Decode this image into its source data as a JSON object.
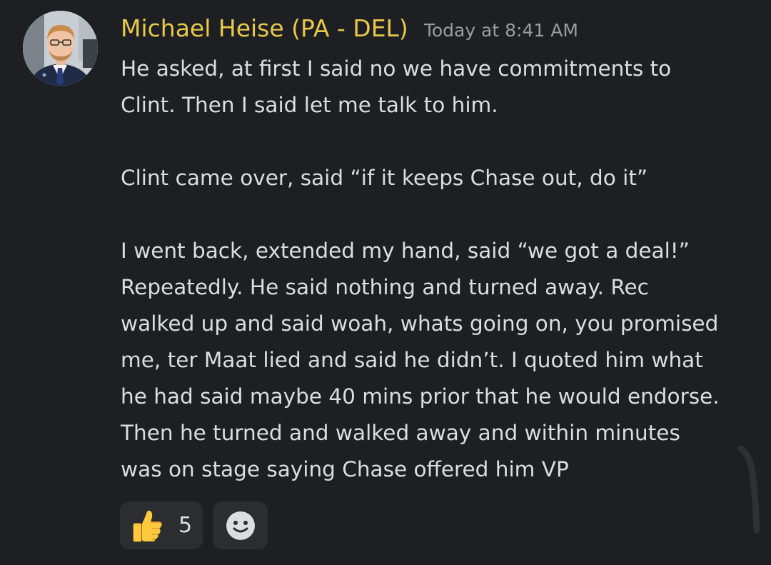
{
  "message": {
    "author": "Michael Heise (PA - DEL)",
    "timestamp": "Today at 8:41 AM",
    "avatar_icon": "user-avatar-photo",
    "author_color": "#e6c84a",
    "paragraphs": [
      [
        "He asked, at first I said no we have commitments to",
        "Clint. Then I said let me talk to him."
      ],
      [
        "Clint came over, said “if it keeps Chase out, do it”"
      ],
      [
        "I went back, extended my hand, said “we got a deal!”",
        "Repeatedly. He said nothing and turned away. Rec",
        "walked up and said woah, whats going on, you promised",
        "me, ter Maat lied and said he didn’t. I quoted him what",
        "he had said maybe 40 mins prior that he would endorse.",
        "Then he turned and walked away and within minutes",
        "was on stage saying Chase offered him VP"
      ]
    ]
  },
  "reactions": {
    "thumbs_up": {
      "emoji": "thumbs-up-icon",
      "count": "5"
    },
    "add_reaction": {
      "icon": "add-reaction-smiley-icon"
    }
  }
}
